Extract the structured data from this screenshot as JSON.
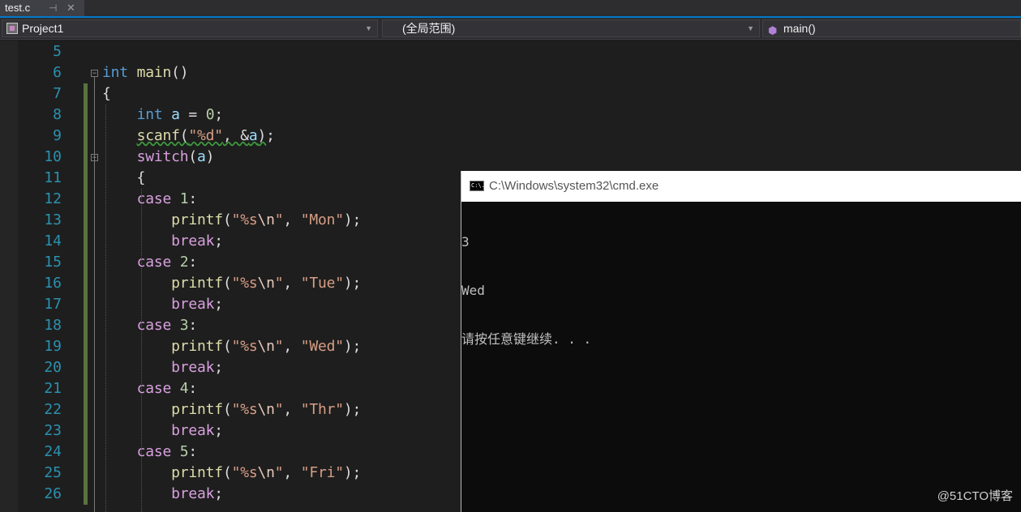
{
  "tab": {
    "title": "test.c",
    "pin_glyph": "⊣",
    "close_glyph": "✕"
  },
  "navbar": {
    "project": "Project1",
    "scope": "(全局范围)",
    "member": "main()"
  },
  "code_lines": [
    {
      "n": "5",
      "code": []
    },
    {
      "n": "6",
      "code": [
        {
          "t": "int",
          "c": "kw"
        },
        {
          "t": " "
        },
        {
          "t": "main",
          "c": "fn"
        },
        {
          "t": "()"
        }
      ]
    },
    {
      "n": "7",
      "code": [
        {
          "t": "{"
        }
      ]
    },
    {
      "n": "8",
      "code": [
        {
          "t": "    "
        },
        {
          "t": "int",
          "c": "kw"
        },
        {
          "t": " "
        },
        {
          "t": "a",
          "c": "var"
        },
        {
          "t": " = "
        },
        {
          "t": "0",
          "c": "num"
        },
        {
          "t": ";"
        }
      ]
    },
    {
      "n": "9",
      "code": [
        {
          "t": "    "
        },
        {
          "t": "scanf",
          "c": "fn squig"
        },
        {
          "t": "(",
          "c": "squig"
        },
        {
          "t": "\"%d\"",
          "c": "str squig"
        },
        {
          "t": ", &",
          "c": "squig"
        },
        {
          "t": "a",
          "c": "var squig"
        },
        {
          "t": ")",
          "c": "squig"
        },
        {
          "t": ";"
        }
      ]
    },
    {
      "n": "10",
      "code": [
        {
          "t": "    "
        },
        {
          "t": "switch",
          "c": "ctl"
        },
        {
          "t": "("
        },
        {
          "t": "a",
          "c": "var"
        },
        {
          "t": ")"
        }
      ]
    },
    {
      "n": "11",
      "code": [
        {
          "t": "    {"
        }
      ]
    },
    {
      "n": "12",
      "code": [
        {
          "t": "    "
        },
        {
          "t": "case",
          "c": "ctl"
        },
        {
          "t": " "
        },
        {
          "t": "1",
          "c": "num"
        },
        {
          "t": ":"
        }
      ]
    },
    {
      "n": "13",
      "code": [
        {
          "t": "        "
        },
        {
          "t": "printf",
          "c": "fn"
        },
        {
          "t": "("
        },
        {
          "t": "\"%s",
          "c": "str"
        },
        {
          "t": "\\n",
          "c": "esc"
        },
        {
          "t": "\"",
          "c": "str"
        },
        {
          "t": ", "
        },
        {
          "t": "\"Mon\"",
          "c": "str"
        },
        {
          "t": ");"
        }
      ]
    },
    {
      "n": "14",
      "code": [
        {
          "t": "        "
        },
        {
          "t": "break",
          "c": "ctl"
        },
        {
          "t": ";"
        }
      ]
    },
    {
      "n": "15",
      "code": [
        {
          "t": "    "
        },
        {
          "t": "case",
          "c": "ctl"
        },
        {
          "t": " "
        },
        {
          "t": "2",
          "c": "num"
        },
        {
          "t": ":"
        }
      ]
    },
    {
      "n": "16",
      "code": [
        {
          "t": "        "
        },
        {
          "t": "printf",
          "c": "fn"
        },
        {
          "t": "("
        },
        {
          "t": "\"%s",
          "c": "str"
        },
        {
          "t": "\\n",
          "c": "esc"
        },
        {
          "t": "\"",
          "c": "str"
        },
        {
          "t": ", "
        },
        {
          "t": "\"Tue\"",
          "c": "str"
        },
        {
          "t": ");"
        }
      ]
    },
    {
      "n": "17",
      "code": [
        {
          "t": "        "
        },
        {
          "t": "break",
          "c": "ctl"
        },
        {
          "t": ";"
        }
      ]
    },
    {
      "n": "18",
      "code": [
        {
          "t": "    "
        },
        {
          "t": "case",
          "c": "ctl"
        },
        {
          "t": " "
        },
        {
          "t": "3",
          "c": "num"
        },
        {
          "t": ":"
        }
      ]
    },
    {
      "n": "19",
      "code": [
        {
          "t": "        "
        },
        {
          "t": "printf",
          "c": "fn"
        },
        {
          "t": "("
        },
        {
          "t": "\"%s",
          "c": "str"
        },
        {
          "t": "\\n",
          "c": "esc"
        },
        {
          "t": "\"",
          "c": "str"
        },
        {
          "t": ", "
        },
        {
          "t": "\"Wed\"",
          "c": "str"
        },
        {
          "t": ");"
        }
      ]
    },
    {
      "n": "20",
      "code": [
        {
          "t": "        "
        },
        {
          "t": "break",
          "c": "ctl"
        },
        {
          "t": ";"
        }
      ]
    },
    {
      "n": "21",
      "code": [
        {
          "t": "    "
        },
        {
          "t": "case",
          "c": "ctl"
        },
        {
          "t": " "
        },
        {
          "t": "4",
          "c": "num"
        },
        {
          "t": ":"
        }
      ]
    },
    {
      "n": "22",
      "code": [
        {
          "t": "        "
        },
        {
          "t": "printf",
          "c": "fn"
        },
        {
          "t": "("
        },
        {
          "t": "\"%s",
          "c": "str"
        },
        {
          "t": "\\n",
          "c": "esc"
        },
        {
          "t": "\"",
          "c": "str"
        },
        {
          "t": ", "
        },
        {
          "t": "\"Thr\"",
          "c": "str"
        },
        {
          "t": ");"
        }
      ]
    },
    {
      "n": "23",
      "code": [
        {
          "t": "        "
        },
        {
          "t": "break",
          "c": "ctl"
        },
        {
          "t": ";"
        }
      ]
    },
    {
      "n": "24",
      "code": [
        {
          "t": "    "
        },
        {
          "t": "case",
          "c": "ctl"
        },
        {
          "t": " "
        },
        {
          "t": "5",
          "c": "num"
        },
        {
          "t": ":"
        }
      ]
    },
    {
      "n": "25",
      "code": [
        {
          "t": "        "
        },
        {
          "t": "printf",
          "c": "fn"
        },
        {
          "t": "("
        },
        {
          "t": "\"%s",
          "c": "str"
        },
        {
          "t": "\\n",
          "c": "esc"
        },
        {
          "t": "\"",
          "c": "str"
        },
        {
          "t": ", "
        },
        {
          "t": "\"Fri\"",
          "c": "str"
        },
        {
          "t": ");"
        }
      ]
    },
    {
      "n": "26",
      "code": [
        {
          "t": "        "
        },
        {
          "t": "break",
          "c": "ctl"
        },
        {
          "t": ";"
        }
      ]
    }
  ],
  "console": {
    "title": "C:\\Windows\\system32\\cmd.exe",
    "icon_label": "C:\\.",
    "output": [
      "3",
      "Wed",
      "请按任意键继续. . ."
    ]
  },
  "watermark": "@51CTO博客",
  "colors": {
    "accent": "#007acc",
    "keyword": "#569cd6",
    "function": "#dcdcaa",
    "string": "#d69d85",
    "control": "#d8a0df",
    "line_number": "#2b91af",
    "change_bar": "#57743d"
  },
  "icons": [
    "project-icon",
    "chevron-down-icon",
    "cube-icon",
    "cmd-icon",
    "pin-icon",
    "close-icon",
    "fold-icon"
  ]
}
